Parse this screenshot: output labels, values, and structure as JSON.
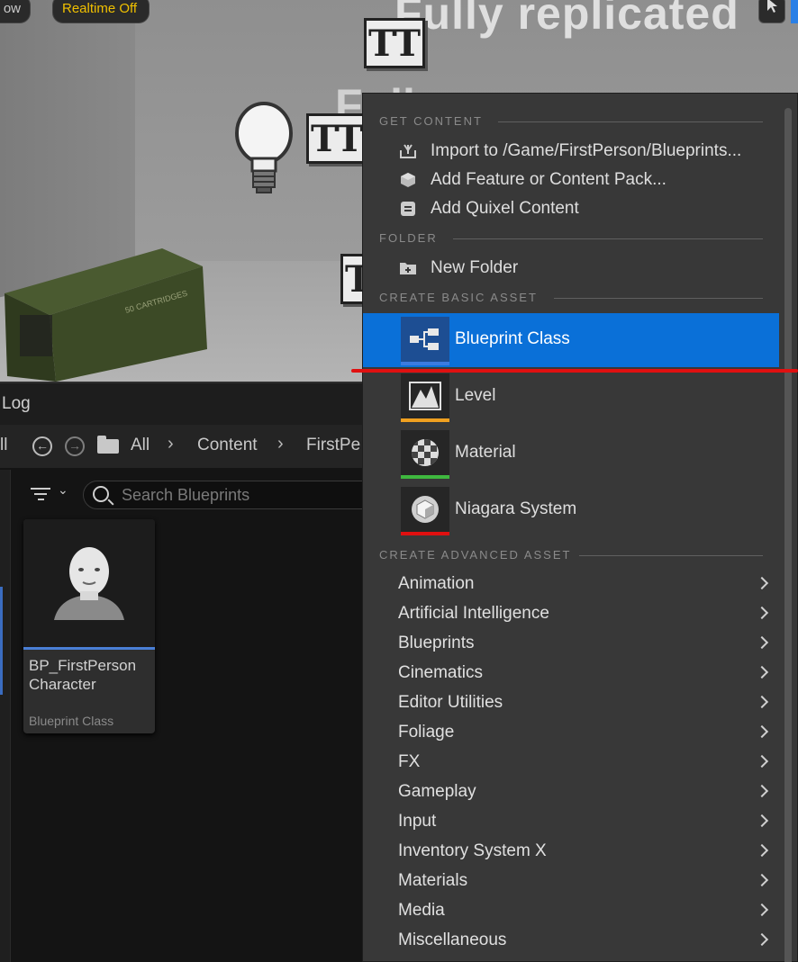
{
  "viewport": {
    "left_pill": "ow",
    "realtime_label": "Realtime Off",
    "title_text": "Fully replicated",
    "subtitle_text": "Full",
    "text_actor_glyph": "TT",
    "ammo_box_text": "50 CARTRIDGES"
  },
  "content_browser": {
    "tab_label": "Log",
    "nav_left_fragment": "ll",
    "breadcrumb": [
      "All",
      "Content",
      "FirstPe"
    ],
    "search": {
      "placeholder": "Search Blueprints",
      "value": ""
    },
    "asset": {
      "name": "BP_FirstPerson Character",
      "type": "Blueprint Class"
    }
  },
  "context_menu": {
    "get_content": {
      "header": "GET CONTENT",
      "items": [
        {
          "label": "Import to /Game/FirstPerson/Blueprints...",
          "icon": "import-icon"
        },
        {
          "label": "Add Feature or Content Pack...",
          "icon": "feature-pack-icon"
        },
        {
          "label": "Add Quixel Content",
          "icon": "quixel-icon"
        }
      ]
    },
    "folder": {
      "header": "FOLDER",
      "items": [
        {
          "label": "New Folder",
          "icon": "new-folder-icon"
        }
      ]
    },
    "basic": {
      "header": "CREATE BASIC ASSET",
      "items": [
        {
          "label": "Blueprint Class",
          "icon": "blueprint-icon",
          "stripe_color": "#3b7be0",
          "selected": true
        },
        {
          "label": "Level",
          "icon": "level-icon",
          "stripe_color": "#f0a020",
          "selected": false
        },
        {
          "label": "Material",
          "icon": "material-icon",
          "stripe_color": "#3fb83f",
          "selected": false
        },
        {
          "label": "Niagara System",
          "icon": "niagara-icon",
          "stripe_color": "#e01010",
          "selected": false
        }
      ]
    },
    "advanced": {
      "header": "CREATE ADVANCED ASSET",
      "items": [
        "Animation",
        "Artificial Intelligence",
        "Blueprints",
        "Cinematics",
        "Editor Utilities",
        "Foliage",
        "FX",
        "Gameplay",
        "Input",
        "Inventory System X",
        "Materials",
        "Media",
        "Miscellaneous"
      ]
    }
  },
  "colors": {
    "selection_blue": "#0a70d8",
    "highlight_underline": "#e01010",
    "realtime_yellow": "#f0c000"
  }
}
